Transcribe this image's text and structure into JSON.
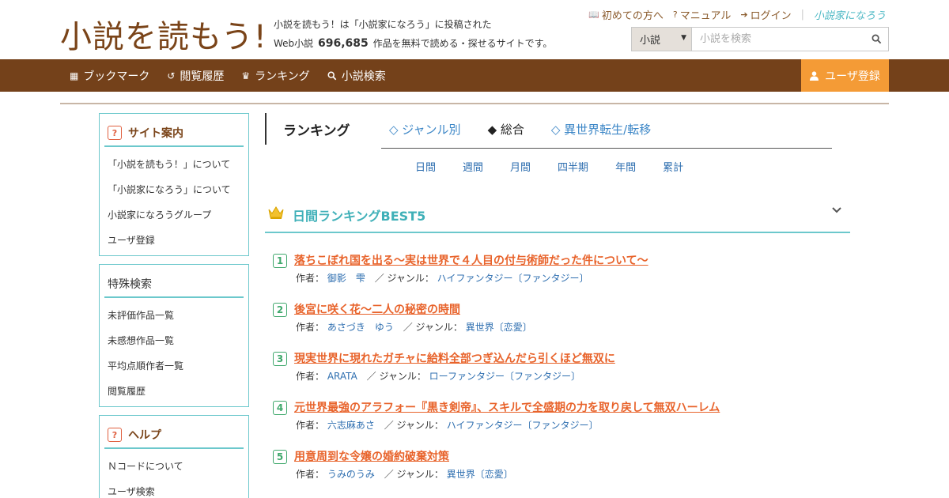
{
  "header": {
    "logo": "小説を読もう!",
    "tagline_line1": "小説を読もう！は「小説家になろう」に投稿された",
    "tagline_prefix": "Web小説",
    "novel_count": "696,685",
    "tagline_suffix": "作品を無料で読める・探せるサイトです。",
    "top_links": [
      {
        "icon": "book-icon",
        "label": "初めての方へ"
      },
      {
        "icon": "help-circle-icon",
        "label": "マニュアル"
      },
      {
        "icon": "login-icon",
        "label": "ログイン"
      }
    ],
    "partner_logo": "小説家になろう",
    "search": {
      "select_value": "小説",
      "placeholder": "小説を検索"
    }
  },
  "nav": {
    "items": [
      {
        "icon": "bookmark-icon",
        "label": "ブックマーク"
      },
      {
        "icon": "history-icon",
        "label": "閲覧履歴"
      },
      {
        "icon": "crown-icon",
        "label": "ランキング"
      },
      {
        "icon": "search-icon",
        "label": "小説検索"
      }
    ],
    "register_label": "ユーザ登録"
  },
  "sidebar": {
    "site_info": {
      "title": "サイト案内",
      "items": [
        "「小説を読もう！」について",
        "「小説家になろう」について",
        "小説家になろうグループ",
        "ユーザ登録"
      ]
    },
    "special_search": {
      "title": "特殊検索",
      "items": [
        "未評価作品一覧",
        "未感想作品一覧",
        "平均点順作者一覧",
        "閲覧履歴"
      ]
    },
    "help": {
      "title": "ヘルプ",
      "items": [
        "Ｎコードについて",
        "ユーザ検索"
      ]
    }
  },
  "main": {
    "title": "ランキング",
    "tabs": [
      "◇ ジャンル別",
      "◆ 総合",
      "◇ 異世界転生/転移"
    ],
    "periods": [
      "日間",
      "週間",
      "月間",
      "四半期",
      "年間",
      "累計"
    ],
    "best_title": "日間ランキングBEST5",
    "author_label": "作者：",
    "genre_label": "／ ジャンル：",
    "rankings": [
      {
        "rank": "1",
        "title": "落ちこぼれ国を出る〜実は世界で４人目の付与術師だった件について〜",
        "author": "御影　雫",
        "genre": "ハイファンタジー〔ファンタジー〕"
      },
      {
        "rank": "2",
        "title": "後宮に咲く花～二人の秘密の時間",
        "author": "あさづき　ゆう",
        "genre": "異世界〔恋愛〕"
      },
      {
        "rank": "3",
        "title": "現実世界に現れたガチャに給料全部つぎ込んだら引くほど無双に",
        "author": "ARATA",
        "genre": "ローファンタジー〔ファンタジー〕"
      },
      {
        "rank": "4",
        "title": "元世界最強のアラフォー『黒き剣帝』、スキルで全盛期の力を取り戻して無双ハーレム",
        "author": "六志麻あさ",
        "genre": "ハイファンタジー〔ファンタジー〕"
      },
      {
        "rank": "5",
        "title": "用意周到な令嬢の婚約破棄対策",
        "author": "うみのうみ",
        "genre": "異世界〔恋愛〕"
      }
    ]
  }
}
